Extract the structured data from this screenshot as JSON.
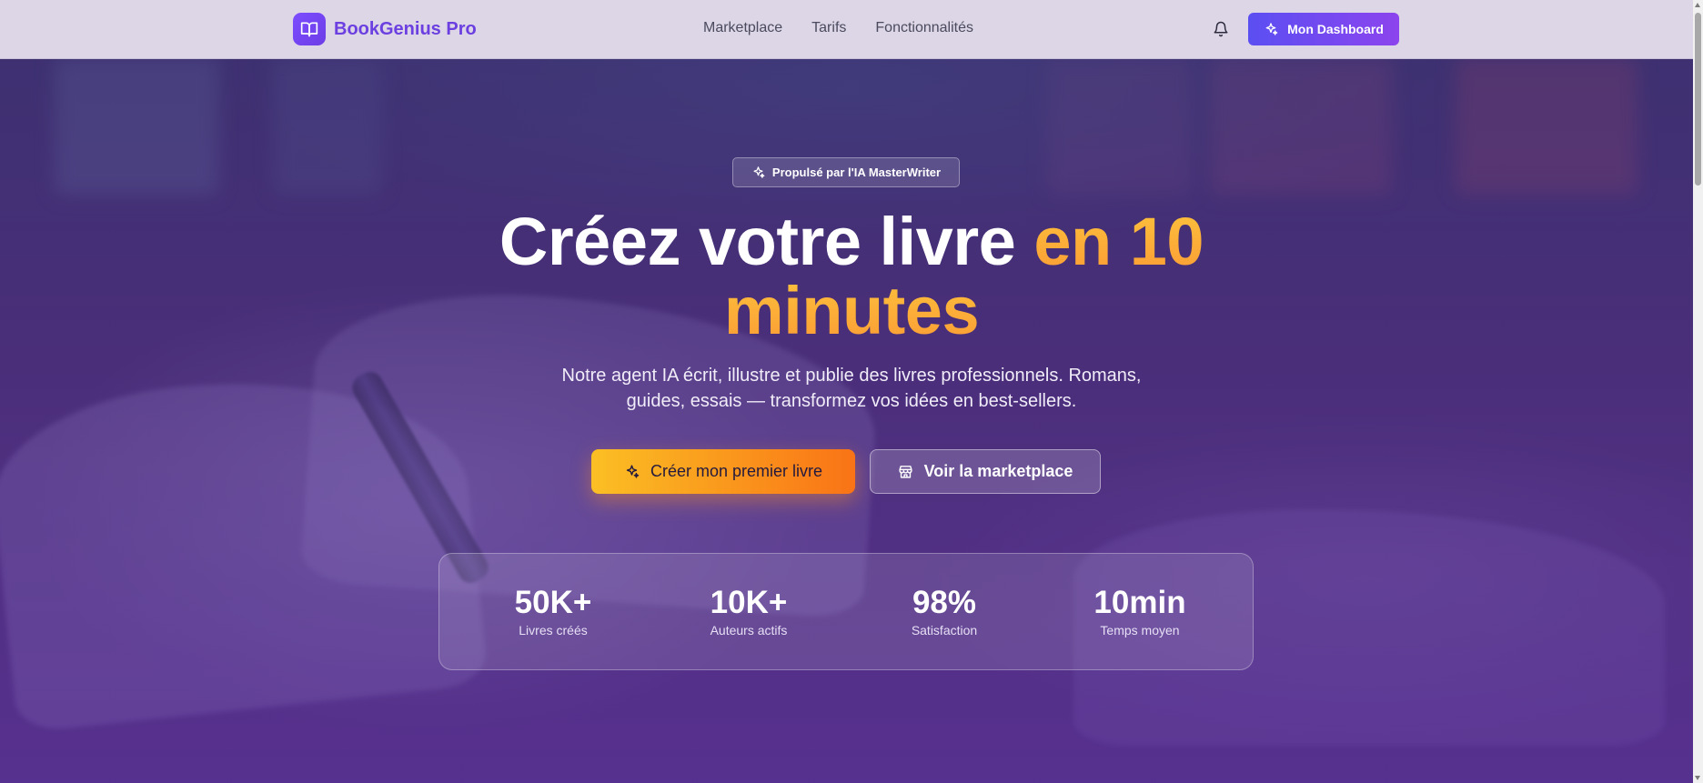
{
  "brand": {
    "name": "BookGenius Pro",
    "icon": "book-open-icon",
    "accent": "#6b3fe0"
  },
  "nav": {
    "links": [
      {
        "label": "Marketplace"
      },
      {
        "label": "Tarifs"
      },
      {
        "label": "Fonctionnalités"
      }
    ],
    "notification_icon": "bell-icon",
    "dashboard_label": "Mon Dashboard",
    "dashboard_icon": "sparkles-icon"
  },
  "hero": {
    "badge": "Propulsé par l'IA MasterWriter",
    "headline_main": "Créez votre livre ",
    "headline_accent": "en 10 minutes",
    "subtitle": "Notre agent IA écrit, illustre et publie des livres professionnels. Romans, guides, essais — transformez vos idées en best-sellers.",
    "cta_primary": "Créer mon premier livre",
    "cta_primary_icon": "sparkles-icon",
    "cta_secondary": "Voir la marketplace",
    "cta_secondary_icon": "store-icon"
  },
  "stats": [
    {
      "value": "50K+",
      "label": "Livres créés"
    },
    {
      "value": "10K+",
      "label": "Auteurs actifs"
    },
    {
      "value": "98%",
      "label": "Satisfaction"
    },
    {
      "value": "10min",
      "label": "Temps moyen"
    }
  ],
  "colors": {
    "primary_gradient": [
      "#5b4ff2",
      "#8c44ee"
    ],
    "cta_gradient": [
      "#fbbf24",
      "#f97316"
    ],
    "hero_background": "#4a2f78"
  }
}
